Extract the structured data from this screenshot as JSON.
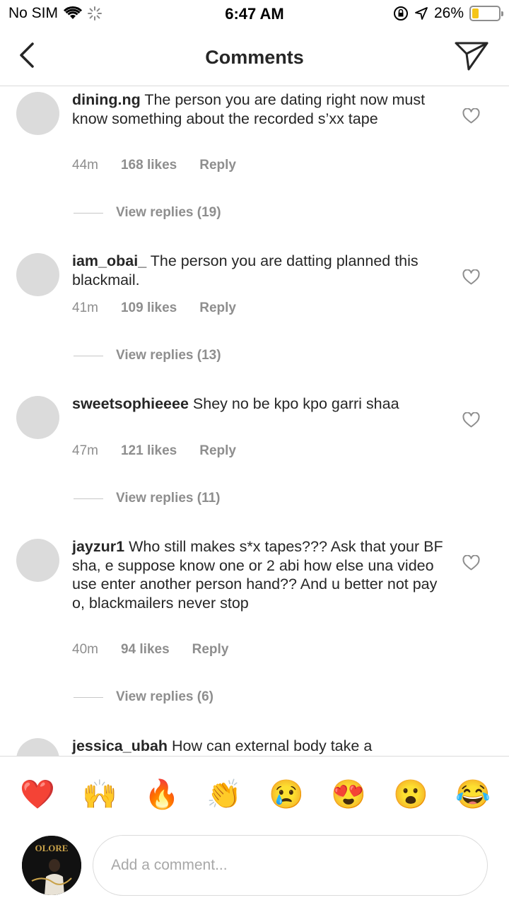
{
  "status": {
    "carrier": "No SIM",
    "time": "6:47 AM",
    "battery": "26%",
    "battery_level": 0.26
  },
  "nav": {
    "title": "Comments",
    "back_icon": "chevron-left-icon",
    "send_icon": "paper-plane-icon"
  },
  "comments": [
    {
      "username": "dining.ng",
      "text": "The person you are dating right now must know something about the recorded s’xx tape",
      "time": "44m",
      "likes": "168 likes",
      "reply": "Reply",
      "view_replies": "View replies (19)"
    },
    {
      "username": "iam_obai_",
      "text": "The person you are datting planned this blackmail.",
      "time": "41m",
      "likes": "109 likes",
      "reply": "Reply",
      "view_replies": "View replies (13)"
    },
    {
      "username": "sweetsophieeee",
      "text": "Shey no be kpo kpo garri shaa",
      "time": "47m",
      "likes": "121 likes",
      "reply": "Reply",
      "view_replies": "View replies (11)"
    },
    {
      "username": "jayzur1",
      "text": "Who still makes s*x tapes??? Ask that your BF sha, e suppose know one or 2 abi how else una video use enter another person hand?? And u better not pay o, blackmailers never stop",
      "time": "40m",
      "likes": "94 likes",
      "reply": "Reply",
      "view_replies": "View replies (6)"
    },
    {
      "username": "jessica_ubah",
      "text": "How can external body take a"
    }
  ],
  "emojis": [
    "❤️",
    "🙌",
    "🔥",
    "👏",
    "😢",
    "😍",
    "😮",
    "😂"
  ],
  "input": {
    "placeholder": "Add a comment...",
    "avatar_text": "OLORE"
  }
}
